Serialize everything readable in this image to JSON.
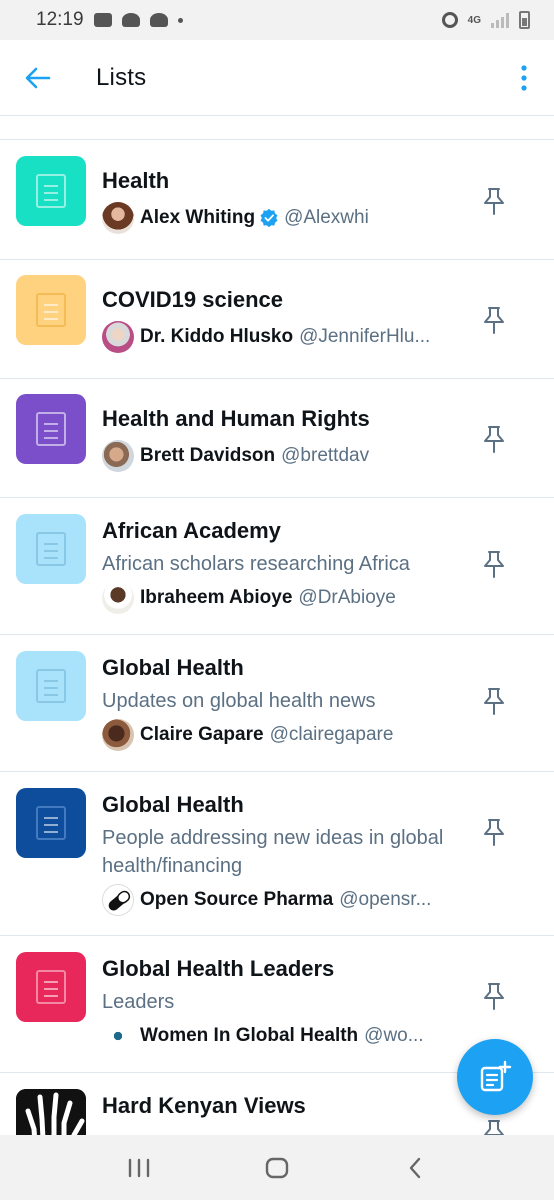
{
  "status_bar": {
    "time": "12:19",
    "network": "4G"
  },
  "header": {
    "title": "Lists",
    "back_icon": "arrow-left-icon",
    "more_icon": "more-vertical-icon",
    "accent_color": "#1da1f2"
  },
  "lists": [
    {
      "name": "Health",
      "description": "",
      "owner_name": "Alex Whiting",
      "owner_verified": true,
      "owner_handle": "@Alexwhi",
      "thumb_color": "#17e0c4"
    },
    {
      "name": "COVID19 science",
      "description": "",
      "owner_name": "Dr. Kiddo Hlusko",
      "owner_verified": false,
      "owner_handle": "@JenniferHlu...",
      "thumb_color": "#ffd27f"
    },
    {
      "name": "Health and Human Rights",
      "description": "",
      "owner_name": "Brett Davidson",
      "owner_verified": false,
      "owner_handle": "@brettdav",
      "thumb_color": "#7b4fc9"
    },
    {
      "name": "African Academy",
      "description": "African scholars researching Africa",
      "owner_name": "Ibraheem Abioye",
      "owner_verified": false,
      "owner_handle": "@DrAbioye",
      "thumb_color": "#a8e3fb"
    },
    {
      "name": "Global Health",
      "description": "Updates on global health news",
      "owner_name": "Claire Gapare",
      "owner_verified": false,
      "owner_handle": "@clairegapare",
      "thumb_color": "#a8e3fb"
    },
    {
      "name": "Global Health",
      "description": "People addressing new ideas in global health/financing",
      "owner_name": "Open Source Pharma",
      "owner_verified": false,
      "owner_handle": "@opensr...",
      "thumb_color": "#0e4c9c"
    },
    {
      "name": "Global Health Leaders",
      "description": "Leaders",
      "owner_name": "Women In Global Health",
      "owner_verified": false,
      "owner_handle": "@wo...",
      "thumb_color": "#e8275a"
    },
    {
      "name": "Hard Kenyan Views",
      "description": "",
      "owner_name": "",
      "owner_verified": false,
      "owner_handle": "",
      "thumb_color": "#111111"
    }
  ],
  "fab": {
    "icon": "new-list-icon"
  }
}
